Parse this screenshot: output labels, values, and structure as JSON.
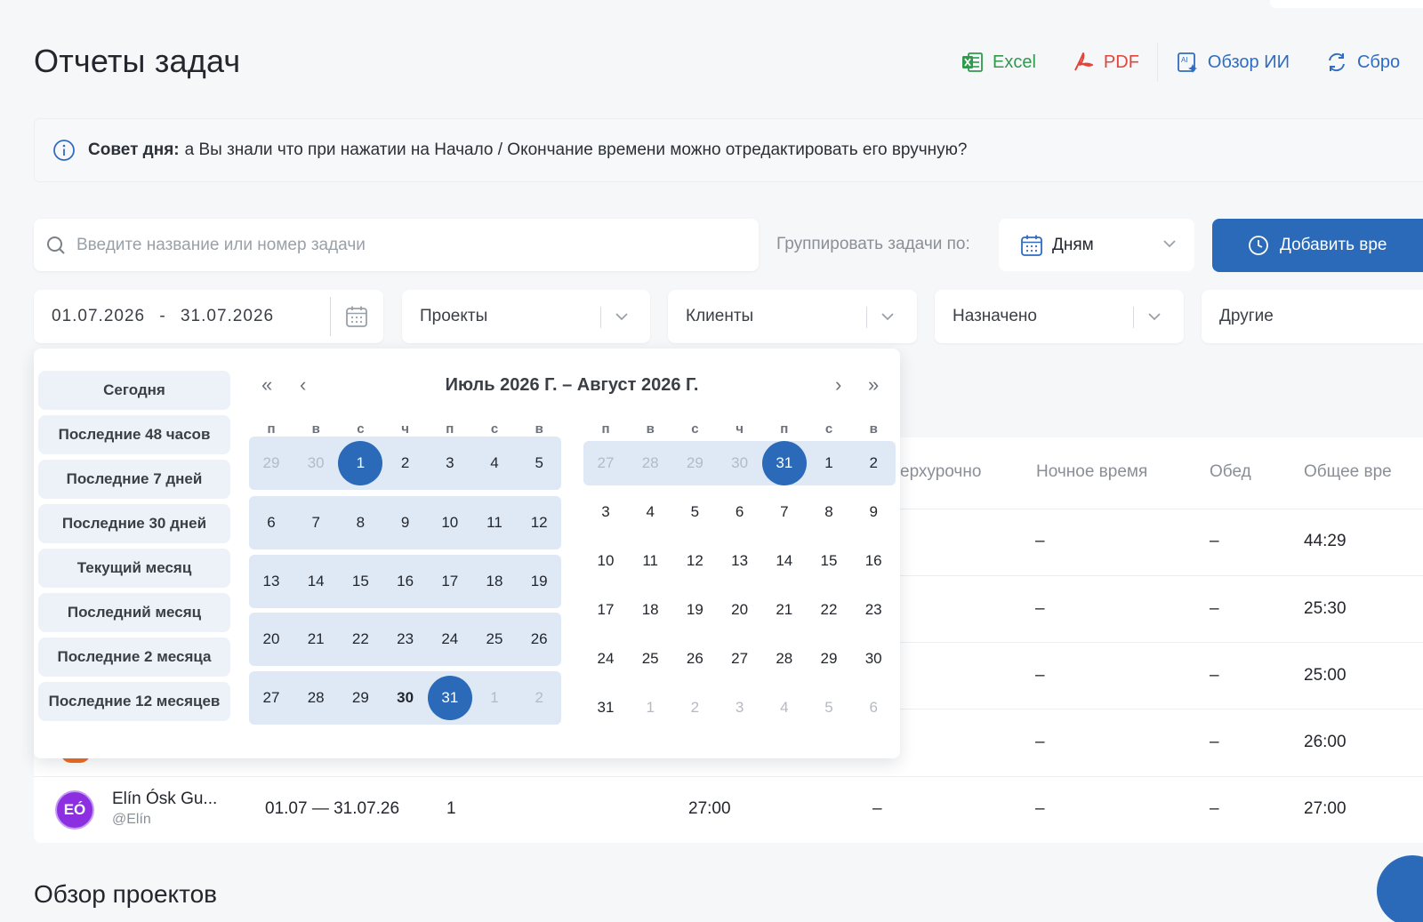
{
  "page": {
    "title": "Отчеты задач"
  },
  "toolbar": {
    "excel": "Excel",
    "pdf": "PDF",
    "ai": "Обзор ИИ",
    "reset": "Сбро"
  },
  "tip": {
    "label": "Совет дня:",
    "text": "а Вы знали что при нажатии на Начало / Окончание времени можно отредактировать его вручную?"
  },
  "search": {
    "placeholder": "Введите название или номер задачи"
  },
  "group": {
    "label": "Группировать задачи по:",
    "value": "Дням"
  },
  "add_button": "Добавить вре",
  "filters": {
    "date_from": "01.07.2026",
    "date_sep": "-",
    "date_to": "31.07.2026",
    "projects": "Проекты",
    "clients": "Клиенты",
    "assigned": "Назначено",
    "other": "Другие"
  },
  "table": {
    "headers": {
      "overtime": "ерхурочно",
      "night": "Ночное время",
      "lunch": "Обед",
      "total": "Общее вре"
    },
    "rows": [
      {
        "night": "–",
        "lunch": "–",
        "total": "44:29"
      },
      {
        "night": "–",
        "lunch": "–",
        "total": "25:30"
      },
      {
        "night": "–",
        "lunch": "–",
        "total": "25:00"
      },
      {
        "night": "–",
        "lunch": "–",
        "total": "26:00"
      },
      {
        "avatar": "EÓ",
        "avatar_color": "#8b2fe0",
        "name": "Elín Ósk Gu...",
        "handle": "@Elín",
        "period": "01.07 — 31.07.26",
        "tasks": "1",
        "time": "27:00",
        "overtime": "–",
        "night": "–",
        "lunch": "–",
        "total": "27:00"
      }
    ]
  },
  "section": {
    "title": "Обзор проектов"
  },
  "picker": {
    "title": "Июль 2026 Г. – Август 2026 Г.",
    "nav": {
      "prev_year": "«",
      "prev_month": "‹",
      "next_month": "›",
      "next_year": "»"
    },
    "presets": [
      "Сегодня",
      "Последние 48 часов",
      "Последние 7 дней",
      "Последние 30 дней",
      "Текущий месяц",
      "Последний месяц",
      "Последние 2 месяца",
      "Последние 12 месяцев"
    ],
    "weekdays": [
      "п",
      "в",
      "с",
      "ч",
      "п",
      "с",
      "в"
    ],
    "months": [
      {
        "name": "July",
        "weeks": [
          [
            {
              "d": "29",
              "m": true
            },
            {
              "d": "30",
              "m": true
            },
            {
              "d": "1",
              "s": true
            },
            {
              "d": "2"
            },
            {
              "d": "3"
            },
            {
              "d": "4"
            },
            {
              "d": "5"
            }
          ],
          [
            {
              "d": "6"
            },
            {
              "d": "7"
            },
            {
              "d": "8"
            },
            {
              "d": "9"
            },
            {
              "d": "10"
            },
            {
              "d": "11"
            },
            {
              "d": "12"
            }
          ],
          [
            {
              "d": "13"
            },
            {
              "d": "14"
            },
            {
              "d": "15"
            },
            {
              "d": "16"
            },
            {
              "d": "17"
            },
            {
              "d": "18"
            },
            {
              "d": "19"
            }
          ],
          [
            {
              "d": "20"
            },
            {
              "d": "21"
            },
            {
              "d": "22"
            },
            {
              "d": "23"
            },
            {
              "d": "24"
            },
            {
              "d": "25"
            },
            {
              "d": "26"
            }
          ],
          [
            {
              "d": "27"
            },
            {
              "d": "28"
            },
            {
              "d": "29"
            },
            {
              "d": "30",
              "b": true
            },
            {
              "d": "31",
              "s": true
            },
            {
              "d": "1",
              "m": true
            },
            {
              "d": "2",
              "m": true
            }
          ]
        ]
      },
      {
        "name": "August",
        "weeks": [
          [
            {
              "d": "27",
              "m": true
            },
            {
              "d": "28",
              "m": true
            },
            {
              "d": "29",
              "m": true
            },
            {
              "d": "30",
              "m": true
            },
            {
              "d": "31",
              "s": true
            },
            {
              "d": "1"
            },
            {
              "d": "2"
            }
          ],
          [
            {
              "d": "3"
            },
            {
              "d": "4"
            },
            {
              "d": "5"
            },
            {
              "d": "6"
            },
            {
              "d": "7"
            },
            {
              "d": "8"
            },
            {
              "d": "9"
            }
          ],
          [
            {
              "d": "10"
            },
            {
              "d": "11"
            },
            {
              "d": "12"
            },
            {
              "d": "13"
            },
            {
              "d": "14"
            },
            {
              "d": "15"
            },
            {
              "d": "16"
            }
          ],
          [
            {
              "d": "17"
            },
            {
              "d": "18"
            },
            {
              "d": "19"
            },
            {
              "d": "20"
            },
            {
              "d": "21"
            },
            {
              "d": "22"
            },
            {
              "d": "23"
            }
          ],
          [
            {
              "d": "24"
            },
            {
              "d": "25"
            },
            {
              "d": "26"
            },
            {
              "d": "27"
            },
            {
              "d": "28"
            },
            {
              "d": "29"
            },
            {
              "d": "30"
            }
          ],
          [
            {
              "d": "31"
            },
            {
              "d": "1",
              "m": true
            },
            {
              "d": "2",
              "m": true
            },
            {
              "d": "3",
              "m": true
            },
            {
              "d": "4",
              "m": true
            },
            {
              "d": "5",
              "m": true
            },
            {
              "d": "6",
              "m": true
            }
          ]
        ]
      }
    ]
  },
  "colors": {
    "primary": "#2b6ab9",
    "excel": "#2f9a4c",
    "pdf": "#e2463a",
    "range_band": "#dfe9f6"
  }
}
